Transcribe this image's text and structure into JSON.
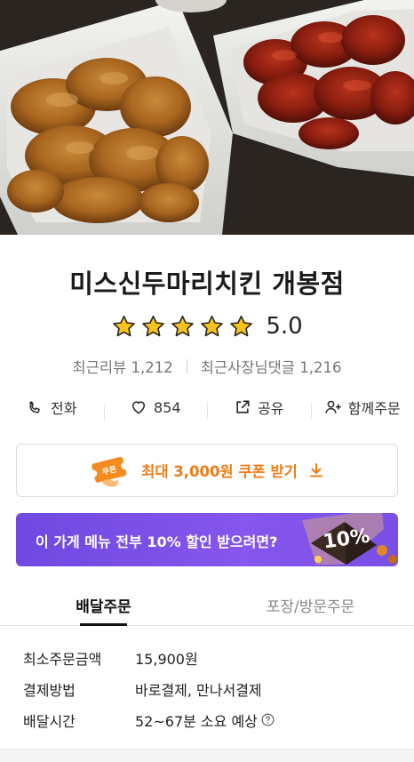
{
  "hero": {
    "image_alt": "fried chicken and spicy chicken in delivery boxes"
  },
  "store": {
    "name": "미스신두마리치킨 개봉점"
  },
  "rating": {
    "value": "5.0",
    "stars": 5
  },
  "stats": {
    "reviews": "최근리뷰 1,212",
    "owner_replies": "최근사장님댓글 1,216"
  },
  "actions": {
    "call": "전화",
    "likes": "854",
    "share": "공유",
    "group_order": "함께주문"
  },
  "coupon": {
    "label": "최대 3,000원 쿠폰 받기",
    "icon_text": "쿠폰"
  },
  "promo": {
    "text": "이 가게 메뉴 전부 10% 할인 받으려면?",
    "badge": "10%"
  },
  "tabs": [
    {
      "label": "배달주문",
      "active": true
    },
    {
      "label": "포장/방문주문",
      "active": false
    }
  ],
  "delivery_info": [
    {
      "label": "최소주문금액",
      "value": "15,900원"
    },
    {
      "label": "결제방법",
      "value": "바로결제, 만나서결제"
    },
    {
      "label": "배달시간",
      "value": "52~67분 소요 예상"
    }
  ],
  "colors": {
    "star": "#f7c21c",
    "coupon_accent": "#f07c16",
    "promo_bg": "#7a4fe6"
  }
}
